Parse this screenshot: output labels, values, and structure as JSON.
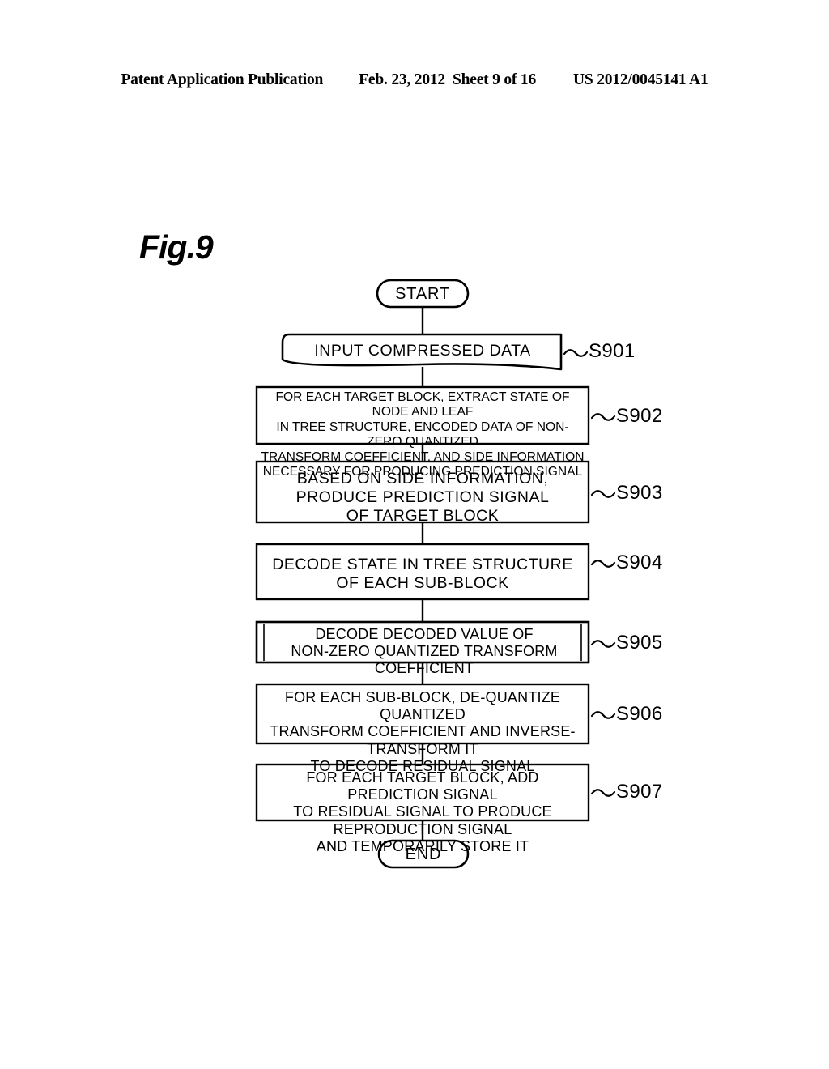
{
  "header": {
    "publication": "Patent Application Publication",
    "date": "Feb. 23, 2012",
    "sheet": "Sheet 9 of 16",
    "number": "US 2012/0045141 A1"
  },
  "figure": {
    "label": "Fig.9"
  },
  "flowchart": {
    "start_label": "START",
    "end_label": "END",
    "steps": [
      {
        "id": "S901",
        "text": "INPUT COMPRESSED DATA",
        "shape": "document"
      },
      {
        "id": "S902",
        "text": "FOR EACH TARGET BLOCK, EXTRACT STATE OF NODE AND LEAF\nIN TREE STRUCTURE, ENCODED DATA OF NON-ZERO QUANTIZED\nTRANSFORM COEFFICIENT, AND SIDE INFORMATION\nNECESSARY FOR PRODUCING PREDICTION SIGNAL",
        "shape": "rect"
      },
      {
        "id": "S903",
        "text": "BASED ON SIDE INFORMATION,\nPRODUCE PREDICTION SIGNAL\nOF TARGET BLOCK",
        "shape": "rect"
      },
      {
        "id": "S904",
        "text": "DECODE STATE IN TREE STRUCTURE\nOF EACH SUB-BLOCK",
        "shape": "rect"
      },
      {
        "id": "S905",
        "text": "DECODE DECODED VALUE OF\nNON-ZERO QUANTIZED TRANSFORM COEFFICIENT",
        "shape": "rect-double"
      },
      {
        "id": "S906",
        "text": "FOR EACH SUB-BLOCK, DE-QUANTIZE QUANTIZED\nTRANSFORM COEFFICIENT AND INVERSE-TRANSFORM IT\nTO DECODE RESIDUAL SIGNAL",
        "shape": "rect"
      },
      {
        "id": "S907",
        "text": "FOR EACH TARGET BLOCK, ADD PREDICTION SIGNAL\nTO RESIDUAL SIGNAL TO PRODUCE REPRODUCTION SIGNAL\nAND TEMPORARILY STORE IT",
        "shape": "rect"
      }
    ]
  },
  "colors": {
    "ink": "#000000",
    "page": "#ffffff"
  }
}
